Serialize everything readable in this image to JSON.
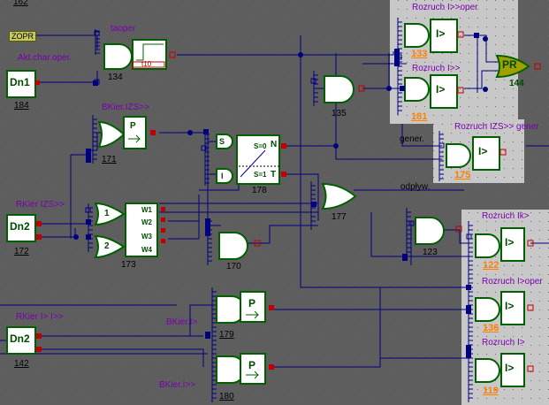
{
  "top_number": "162",
  "zopr_tag": "ZOPR",
  "labels": {
    "akt_char": "Akt.char.oper.",
    "taoper": "taoper",
    "bkier_izs": "BKier.IZS>>",
    "rkier_izs": "RKier IZS>>",
    "rkier_i": "RKier I> I>>",
    "bkier_i1": "BKier.I>",
    "bkier_i2": "BKier.I>>",
    "gener": "gener.",
    "odplyw": "odpływ.",
    "rozruch_i_oper": "Rozruch I>>oper",
    "rozruch_i2": "Rozruch I>>",
    "rozruch_izs": "Rozruch IZS>> gener",
    "rozruch_ik": "Rozruch Ik>",
    "rozruch_i_oper2": "Rozruch I>oper",
    "rozruch_i1": "Rozruch I>"
  },
  "blocks": {
    "dn1": {
      "text": "Dn1",
      "num": "184"
    },
    "dn2a": {
      "text": "Dn2",
      "num": "172"
    },
    "dn2b": {
      "text": "Dn2",
      "num": "142"
    },
    "and134": "134",
    "timer_t10": "t10",
    "p171": {
      "text": "P",
      "num": "171"
    },
    "flip178": {
      "s": "S",
      "r": "I",
      "s0": "S=0",
      "s1": "S=1",
      "n": "N",
      "t": "T",
      "num": "178"
    },
    "mux173": {
      "in1": "1",
      "in2": "2",
      "w1": "W1",
      "w2": "W2",
      "w3": "W3",
      "w4": "W4",
      "num": "173"
    },
    "and135": "135",
    "and170": "170",
    "or177": "177",
    "and123": "123",
    "p179": {
      "text": "P",
      "num": "179"
    },
    "p180": {
      "text": "P",
      "num": "180"
    },
    "pr144": {
      "text": "PR",
      "num": "144"
    },
    "cmp133": {
      "text": "I>",
      "num": "133"
    },
    "cmp181": {
      "text": "I>",
      "num": "181"
    },
    "cmp175": {
      "text": "I>",
      "num": "175"
    },
    "cmp122": {
      "text": "I>",
      "num": "122"
    },
    "cmp136": {
      "text": "I>",
      "num": "136"
    },
    "cmp119": {
      "text": "I>",
      "num": "119"
    }
  },
  "colors": {
    "background": "#5e5e5e",
    "block_stroke": "#006000",
    "block_fill": "#ffffff",
    "wire": "#000080",
    "port_red": "#c00000",
    "port_blue": "#000080",
    "panel": "#c8c8c8",
    "label_purple": "#7a00b0",
    "number_orange": "#ff8000"
  }
}
